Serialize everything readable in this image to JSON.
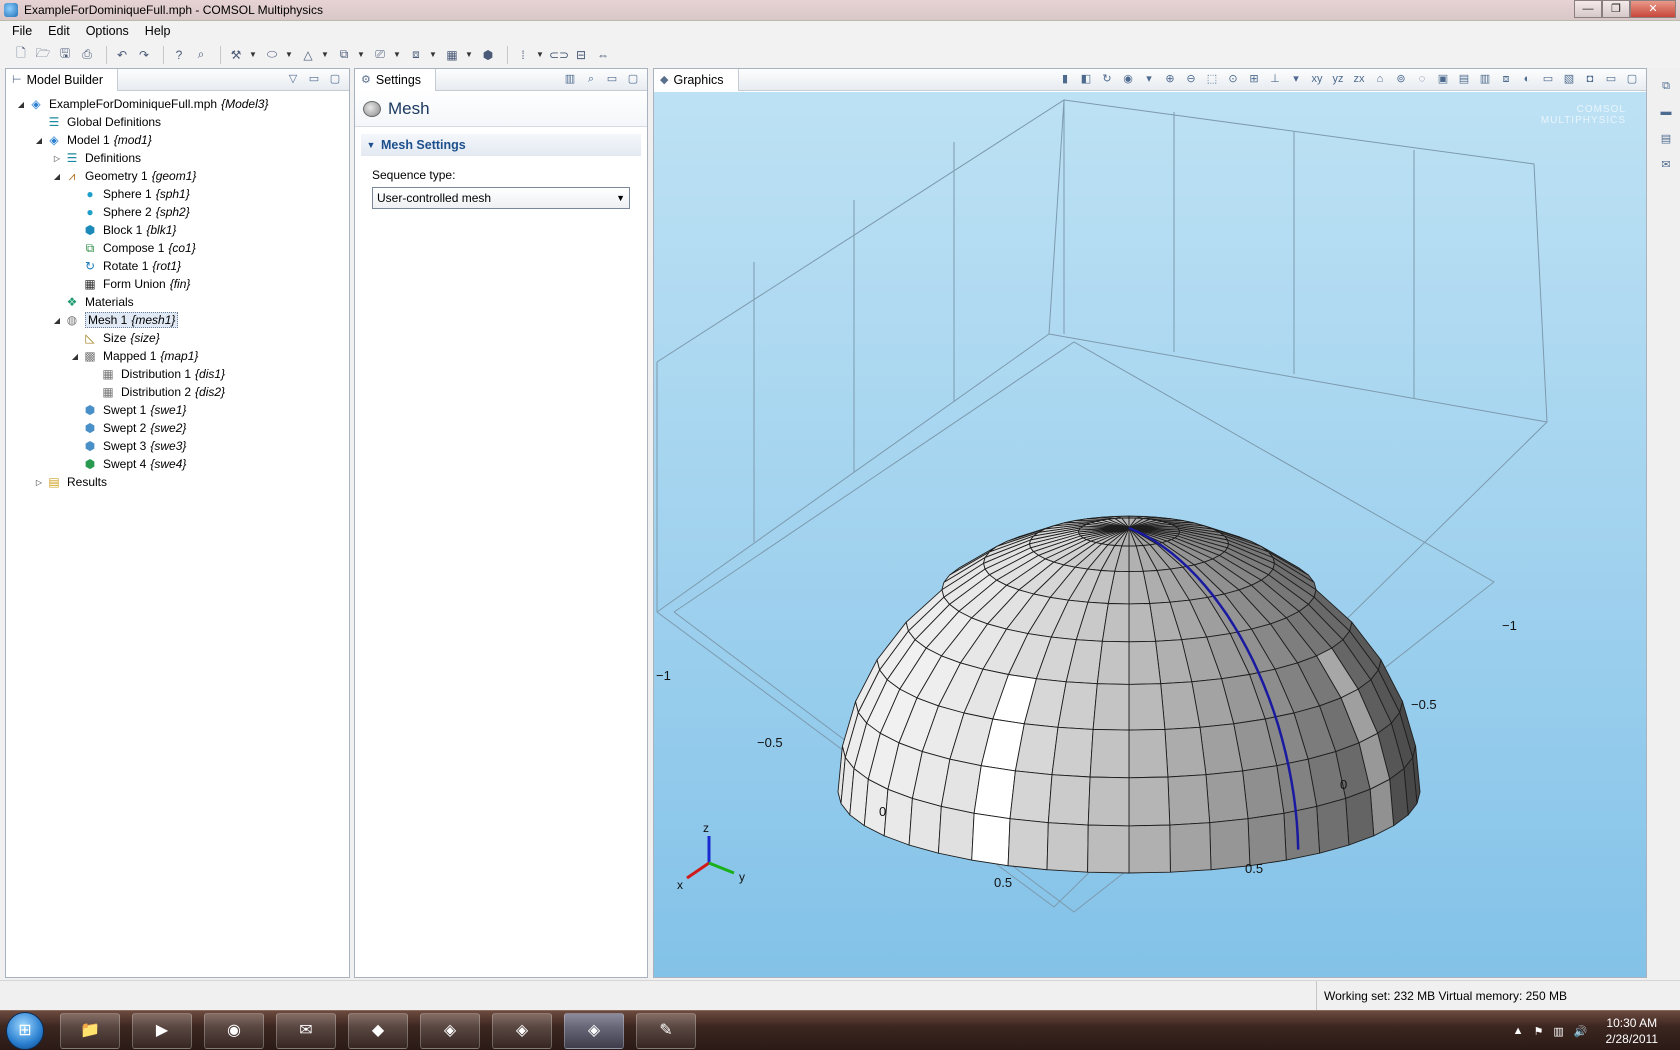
{
  "window": {
    "title": "ExampleForDominiqueFull.mph - COMSOL Multiphysics",
    "minimize": "—",
    "maximize": "❐",
    "close": "✕"
  },
  "menu": [
    "File",
    "Edit",
    "Options",
    "Help"
  ],
  "model_builder": {
    "tab_label": "Model Builder",
    "tree": [
      {
        "label": "ExampleForDominiqueFull.mph",
        "tag": "{Model3}",
        "indent": 0,
        "twisty": "◢",
        "icon": "model-file-icon",
        "glyph": "◈",
        "color": "#2a7fd0"
      },
      {
        "label": "Global Definitions",
        "tag": "",
        "indent": 1,
        "twisty": "",
        "icon": "global-definitions-icon",
        "glyph": "☰",
        "color": "#1c8aa0"
      },
      {
        "label": "Model 1",
        "tag": "{mod1}",
        "indent": 1,
        "twisty": "◢",
        "icon": "model-icon",
        "glyph": "◈",
        "color": "#2a7fd0"
      },
      {
        "label": "Definitions",
        "tag": "",
        "indent": 2,
        "twisty": "▷",
        "icon": "definitions-icon",
        "glyph": "☰",
        "color": "#1c8aa0"
      },
      {
        "label": "Geometry 1",
        "tag": "{geom1}",
        "indent": 2,
        "twisty": "◢",
        "icon": "geometry-icon",
        "glyph": "⩘",
        "color": "#b07020"
      },
      {
        "label": "Sphere 1",
        "tag": "{sph1}",
        "indent": 3,
        "twisty": "",
        "icon": "sphere-icon",
        "glyph": "●",
        "color": "#1ca0c8"
      },
      {
        "label": "Sphere 2",
        "tag": "{sph2}",
        "indent": 3,
        "twisty": "",
        "icon": "sphere-icon",
        "glyph": "●",
        "color": "#1ca0c8"
      },
      {
        "label": "Block 1",
        "tag": "{blk1}",
        "indent": 3,
        "twisty": "",
        "icon": "block-icon",
        "glyph": "⬢",
        "color": "#1c8ab8"
      },
      {
        "label": "Compose 1",
        "tag": "{co1}",
        "indent": 3,
        "twisty": "",
        "icon": "compose-icon",
        "glyph": "⧉",
        "color": "#2a8a40"
      },
      {
        "label": "Rotate 1",
        "tag": "{rot1}",
        "indent": 3,
        "twisty": "",
        "icon": "rotate-icon",
        "glyph": "↻",
        "color": "#1c7ab8"
      },
      {
        "label": "Form Union",
        "tag": "{fin}",
        "indent": 3,
        "twisty": "",
        "icon": "form-union-icon",
        "glyph": "▦",
        "color": "#333333"
      },
      {
        "label": "Materials",
        "tag": "",
        "indent": 2,
        "twisty": "",
        "icon": "materials-icon",
        "glyph": "❖",
        "color": "#1c9a70"
      },
      {
        "label": "Mesh 1",
        "tag": "{mesh1}",
        "indent": 2,
        "twisty": "◢",
        "icon": "mesh-icon",
        "glyph": "◍",
        "color": "#777777",
        "selected": true
      },
      {
        "label": "Size",
        "tag": "{size}",
        "indent": 3,
        "twisty": "",
        "icon": "size-icon",
        "glyph": "◺",
        "color": "#a08020"
      },
      {
        "label": "Mapped 1",
        "tag": "{map1}",
        "indent": 3,
        "twisty": "◢",
        "icon": "mapped-icon",
        "glyph": "▩",
        "color": "#777777"
      },
      {
        "label": "Distribution 1",
        "tag": "{dis1}",
        "indent": 4,
        "twisty": "",
        "icon": "distribution-icon",
        "glyph": "▦",
        "color": "#777777"
      },
      {
        "label": "Distribution 2",
        "tag": "{dis2}",
        "indent": 4,
        "twisty": "",
        "icon": "distribution-icon",
        "glyph": "▦",
        "color": "#777777"
      },
      {
        "label": "Swept 1",
        "tag": "{swe1}",
        "indent": 3,
        "twisty": "",
        "icon": "swept-icon",
        "glyph": "⬢",
        "color": "#4a90c8"
      },
      {
        "label": "Swept 2",
        "tag": "{swe2}",
        "indent": 3,
        "twisty": "",
        "icon": "swept-icon",
        "glyph": "⬢",
        "color": "#4a90c8"
      },
      {
        "label": "Swept 3",
        "tag": "{swe3}",
        "indent": 3,
        "twisty": "",
        "icon": "swept-icon",
        "glyph": "⬢",
        "color": "#4a90c8"
      },
      {
        "label": "Swept 4",
        "tag": "{swe4}",
        "indent": 3,
        "twisty": "",
        "icon": "swept-icon",
        "glyph": "⬢",
        "color": "#2a9a50"
      },
      {
        "label": "Results",
        "tag": "",
        "indent": 1,
        "twisty": "▷",
        "icon": "results-icon",
        "glyph": "▤",
        "color": "#d0a020"
      }
    ]
  },
  "settings": {
    "tab_label": "Settings",
    "node_title": "Mesh",
    "section_title": "Mesh Settings",
    "sequence_type_label": "Sequence type:",
    "sequence_type_value": "User-controlled mesh"
  },
  "graphics": {
    "tab_label": "Graphics",
    "logo_line1": "COMSOL",
    "logo_line2": "MULTIPHYSICS",
    "axis_labels": {
      "left_minus1": "−1",
      "x_minus05": "−0.5",
      "x_0": "0",
      "x_05": "0.5",
      "right_minus1": "−1",
      "y_minus05": "−0.5",
      "y_0": "0",
      "y_05": "0.5"
    },
    "triad": {
      "z": "z",
      "x": "x",
      "y": "y"
    },
    "colors": {
      "background_top": "#bde1f4",
      "background_bottom": "#83c2e8",
      "edge_highlight": "#1a1aa0"
    }
  },
  "status": {
    "text": "Working set: 232 MB  Virtual memory: 250 MB"
  },
  "taskbar": {
    "start": "⊞",
    "apps": [
      {
        "name": "explorer",
        "glyph": "📁"
      },
      {
        "name": "media-player",
        "glyph": "▶"
      },
      {
        "name": "firefox",
        "glyph": "◉"
      },
      {
        "name": "thunderbird",
        "glyph": "✉"
      },
      {
        "name": "app-5",
        "glyph": "◆"
      },
      {
        "name": "app-6",
        "glyph": "◈"
      },
      {
        "name": "app-7",
        "glyph": "◈"
      },
      {
        "name": "comsol",
        "glyph": "◈",
        "active": true
      },
      {
        "name": "paint",
        "glyph": "✎"
      }
    ],
    "time": "10:30 AM",
    "date": "2/28/2011"
  }
}
